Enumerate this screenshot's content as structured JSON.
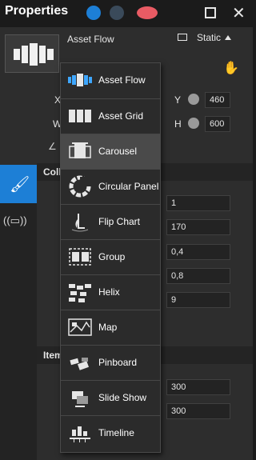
{
  "window": {
    "title": "Properties"
  },
  "header_icons": [
    "globe-blue-icon",
    "globe-grey-icon",
    "speech-bubble-icon",
    "restore-window-icon",
    "close-icon"
  ],
  "control": {
    "name": "Asset Flow",
    "mode": "Static"
  },
  "geometry": {
    "x_label": "X",
    "y_label": "Y",
    "w_label": "W",
    "h_label": "H",
    "y_value": "460",
    "h_value": "600"
  },
  "sections": {
    "collection": "Coll",
    "items": "Item"
  },
  "fields": [
    "1",
    "170",
    "0,4",
    "0,8",
    "9",
    "300",
    "300"
  ],
  "menu": {
    "selected_index": 2,
    "items": [
      {
        "label": "Asset Flow",
        "icon": "asset-flow-icon"
      },
      {
        "label": "Asset Grid",
        "icon": "asset-grid-icon"
      },
      {
        "label": "Carousel",
        "icon": "carousel-icon"
      },
      {
        "label": "Circular Panel",
        "icon": "circular-panel-icon"
      },
      {
        "label": "Flip Chart",
        "icon": "flip-chart-icon"
      },
      {
        "label": "Group",
        "icon": "group-icon"
      },
      {
        "label": "Helix",
        "icon": "helix-icon"
      },
      {
        "label": "Map",
        "icon": "map-icon"
      },
      {
        "label": "Pinboard",
        "icon": "pinboard-icon"
      },
      {
        "label": "Slide Show",
        "icon": "slide-show-icon"
      },
      {
        "label": "Timeline",
        "icon": "timeline-icon"
      }
    ]
  },
  "colors": {
    "accent": "#1d7fd6",
    "bubble": "#e95b64",
    "background": "#2d2d2d"
  }
}
